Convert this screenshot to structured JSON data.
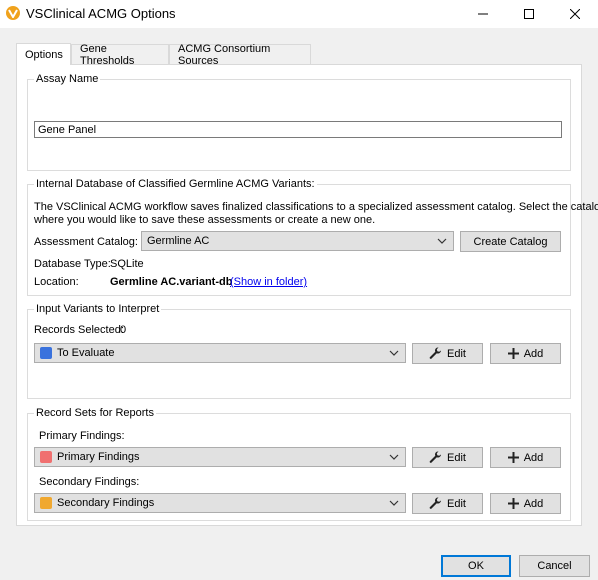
{
  "window": {
    "title": "VSClinical ACMG Options",
    "app_icon": "vsclinical-logo-icon",
    "controls": [
      "minimize-icon",
      "maximize-icon",
      "close-icon"
    ]
  },
  "tabs": [
    {
      "label": "Options",
      "active": true
    },
    {
      "label": "Gene Thresholds",
      "active": false
    },
    {
      "label": "ACMG Consortium Sources",
      "active": false
    }
  ],
  "assay": {
    "group_title": "Assay Name",
    "value": "Gene Panel"
  },
  "catalog": {
    "group_title": "Internal Database of Classified Germline ACMG Variants:",
    "description_line1": "The VSClinical ACMG workflow saves finalized classifications to a specialized assessment catalog. Select the catalog",
    "description_line2": "where you would like to save these assessments or create a new one.",
    "catalog_label": "Assessment Catalog:",
    "catalog_value": "Germline AC",
    "create_button": "Create Catalog",
    "db_type_label": "Database Type:",
    "db_type_value": "SQLite",
    "location_label": "Location:",
    "location_value": "Germline AC.variant-db",
    "show_in_folder": "(Show in folder)"
  },
  "input_variants": {
    "group_title": "Input Variants to Interpret",
    "records_selected_label": "Records Selected:",
    "records_selected_value": "0",
    "combo_value": "To Evaluate",
    "combo_color": "#3a72dd",
    "edit_label": "Edit",
    "add_label": "Add"
  },
  "record_sets": {
    "group_title": "Record Sets for Reports",
    "primary_label": "Primary Findings:",
    "primary_value": "Primary Findings",
    "primary_color": "#f07070",
    "secondary_label": "Secondary Findings:",
    "secondary_value": "Secondary Findings",
    "secondary_color": "#f0a830",
    "edit_label": "Edit",
    "add_label": "Add"
  },
  "footer": {
    "ok": "OK",
    "cancel": "Cancel"
  }
}
